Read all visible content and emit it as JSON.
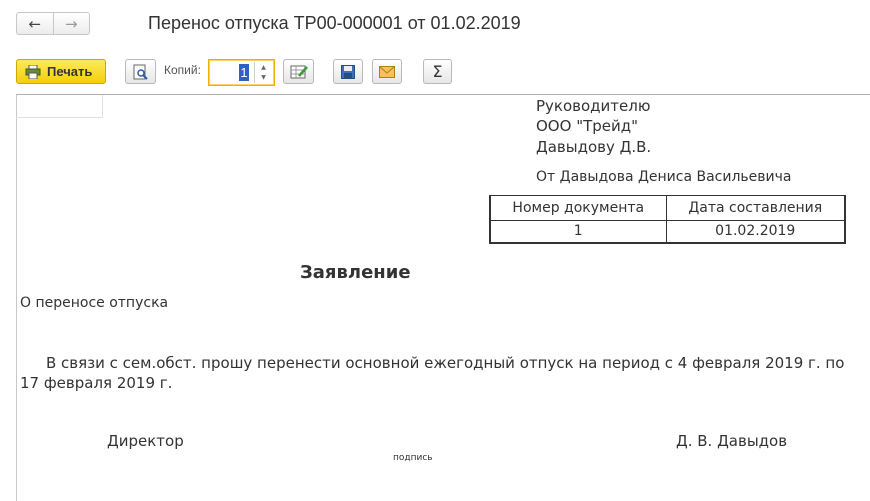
{
  "window": {
    "title": "Перенос отпуска ТР00-000001 от 01.02.2019",
    "back_icon": "←",
    "forward_icon": "→"
  },
  "toolbar": {
    "print_label": "Печать",
    "copies_label": "Копий:",
    "copies_value": "1"
  },
  "document": {
    "addressee": [
      "Руководителю",
      "ООО \"Трейд\"",
      "Давыдову Д.В."
    ],
    "from": "От Давыдова Дениса Васильевича",
    "table": {
      "headers": [
        "Номер документа",
        "Дата составления"
      ],
      "values": [
        "1",
        "01.02.2019"
      ]
    },
    "heading": "Заявление",
    "subject": "О переносе отпуска",
    "body": "В связи с сем.обст. прошу перенести основной ежегодный отпуск на период с 4 февраля 2019 г. по 17 февраля 2019 г.",
    "signature": {
      "position": "Директор",
      "caption": "подпись",
      "name": "Д. В. Давыдов"
    }
  },
  "colors": {
    "print_button": "#f3cf0a",
    "active_field_border": "#f0b000",
    "selection": "#3160c4"
  }
}
